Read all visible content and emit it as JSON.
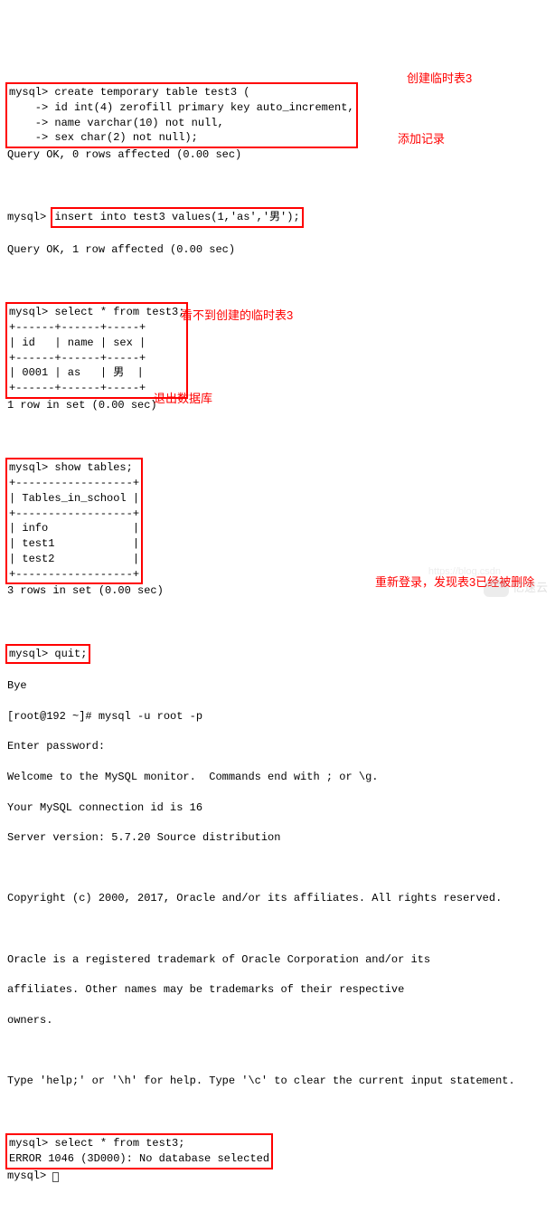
{
  "block1": {
    "l1": "mysql> create temporary table test3 (",
    "l2": "    -> id int(4) zerofill primary key auto_increment,",
    "l3": "    -> name varchar(10) not null,",
    "l4": "    -> sex char(2) not null);"
  },
  "result1": "Query OK, 0 rows affected (0.00 sec)",
  "ann1": "创建临时表3",
  "insert_prefix": "mysql> ",
  "insert_stmt": "insert into test3 values(1,'as','男');",
  "result2": "Query OK, 1 row affected (0.00 sec)",
  "ann2": "添加记录",
  "select_block": {
    "l1": "mysql> select * from test3;",
    "l2": "+------+------+-----+",
    "l3": "| id   | name | sex |",
    "l4": "+------+------+-----+",
    "l5": "| 0001 | as   | 男  |",
    "l6": "+------+------+-----+"
  },
  "result3": "1 row in set (0.00 sec)",
  "show_block": {
    "l1": "mysql> show tables;",
    "l2": "+------------------+",
    "l3": "| Tables_in_school |",
    "l4": "+------------------+",
    "l5": "| info             |",
    "l6": "| test1            |",
    "l7": "| test2            |",
    "l8": "+------------------+"
  },
  "ann3": "看不到创建的临时表3",
  "result4": "3 rows in set (0.00 sec)",
  "quit_stmt": "mysql> quit;",
  "ann4": "退出数据库",
  "bye": "Bye",
  "login1": "[root@192 ~]# mysql -u root -p",
  "login2": "Enter password:",
  "login3": "Welcome to the MySQL monitor.  Commands end with ; or \\g.",
  "login4": "Your MySQL connection id is 16",
  "login5": "Server version: 5.7.20 Source distribution",
  "copyright": "Copyright (c) 2000, 2017, Oracle and/or its affiliates. All rights reserved.",
  "trademark1": "Oracle is a registered trademark of Oracle Corporation and/or its",
  "trademark2": "affiliates. Other names may be trademarks of their respective",
  "trademark3": "owners.",
  "help": "Type 'help;' or '\\h' for help. Type '\\c' to clear the current input statement.",
  "error_block": {
    "l1": "mysql> select * from test3;",
    "l2": "ERROR 1046 (3D000): No database selected"
  },
  "ann5": "重新登录，发现表3已经被删除",
  "final_prompt": "mysql> ",
  "watermark_text": "亿速云",
  "watermark_url": "https://blog.csdn"
}
